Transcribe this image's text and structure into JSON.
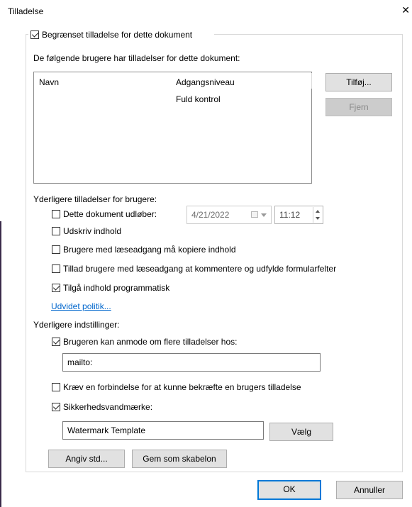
{
  "dialog": {
    "title": "Tilladelse",
    "close_glyph": "✕"
  },
  "restrict": {
    "label": "Begrænset tilladelse for dette dokument",
    "checked": true
  },
  "users_section": {
    "heading": "De følgende brugere har tilladelser for dette dokument:",
    "columns": [
      "Navn",
      "Adgangsniveau"
    ],
    "rows": [
      {
        "name": "",
        "access": "Fuld kontrol"
      }
    ],
    "add_button": "Tilføj...",
    "remove_button": "Fjern"
  },
  "additional_permissions": {
    "heading": "Yderligere tilladelser for brugere:",
    "expires": {
      "label": "Dette dokument udløber:",
      "checked": false,
      "date": "4/21/2022",
      "time": "11:12",
      "calendar_icon": "calendar-icon"
    },
    "print": {
      "label": "Udskriv indhold",
      "checked": false
    },
    "copy": {
      "label": "Brugere med læseadgang må kopiere indhold",
      "checked": false
    },
    "comment": {
      "label": "Tillad brugere med læseadgang at kommentere og udfylde formularfelter",
      "checked": false
    },
    "programmatic": {
      "label": "Tilgå indhold programmatisk",
      "checked": true
    },
    "advanced_link": "Udvidet politik..."
  },
  "additional_settings": {
    "heading": "Yderligere indstillinger:",
    "request": {
      "label": "Brugeren kan anmode om flere tilladelser hos:",
      "checked": true,
      "value": "mailto:"
    },
    "connection": {
      "label": "Kræv en forbindelse for at kunne bekræfte en brugers tilladelse",
      "checked": false
    },
    "watermark": {
      "label": "Sikkerhedsvandmærke:",
      "checked": true,
      "value": "Watermark Template",
      "choose_button": "Vælg"
    },
    "set_defaults_button": "Angiv std...",
    "save_template_button": "Gem som skabelon"
  },
  "footer": {
    "ok_button": "OK",
    "cancel_button": "Annuller"
  },
  "colors": {
    "accent": "#0078d7",
    "link": "#0066cc",
    "button_bg": "#e1e1e1"
  }
}
